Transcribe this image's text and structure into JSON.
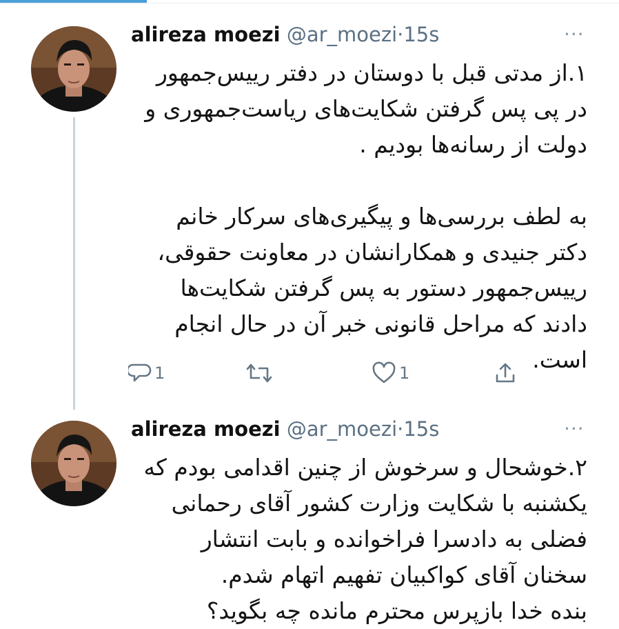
{
  "tweets": [
    {
      "author": {
        "name": "alireza moezi",
        "handle": "@ar_moezi"
      },
      "separator": "·",
      "time": "15s",
      "more": "···",
      "text": "۱.از مدتی قبل با دوستان در دفتر رییس‌جمهور\nدر پی پس گرفتن شکایت‌های ریاست‌جمهوری و\nدولت از رسانه‌ها بودیم .\n\nبه لطف بررسی‌ها و پیگیری‌های سرکار خانم\nدکتر جنیدی و همکارانشان در معاونت حقوقی،\nرییس‌جمهور دستور به پس گرفتن شکایت‌ها\nدادند که مراحل قانونی خبر آن در حال انجام\nاست.",
      "actions": {
        "reply_count": "1",
        "like_count": "1"
      }
    },
    {
      "author": {
        "name": "alireza moezi",
        "handle": "@ar_moezi"
      },
      "separator": "·",
      "time": "15s",
      "more": "···",
      "text": "۲.خوشحال و سرخوش از چنین اقدامی بودم که\nیکشنبه با شکایت وزارت کشور آقای رحمانی\nفضلی به دادسرا فراخوانده و بابت انتشار\nسخنان آقای کواکبیان تفهیم اتهام شدم.\nبنده خدا بازپرس محترم مانده چه بگوید؟"
    }
  ],
  "colors": {
    "accent": "#4a9fd8",
    "thread_line": "#c9d3da",
    "meta_text": "#5b7083",
    "icon": "#657786"
  }
}
